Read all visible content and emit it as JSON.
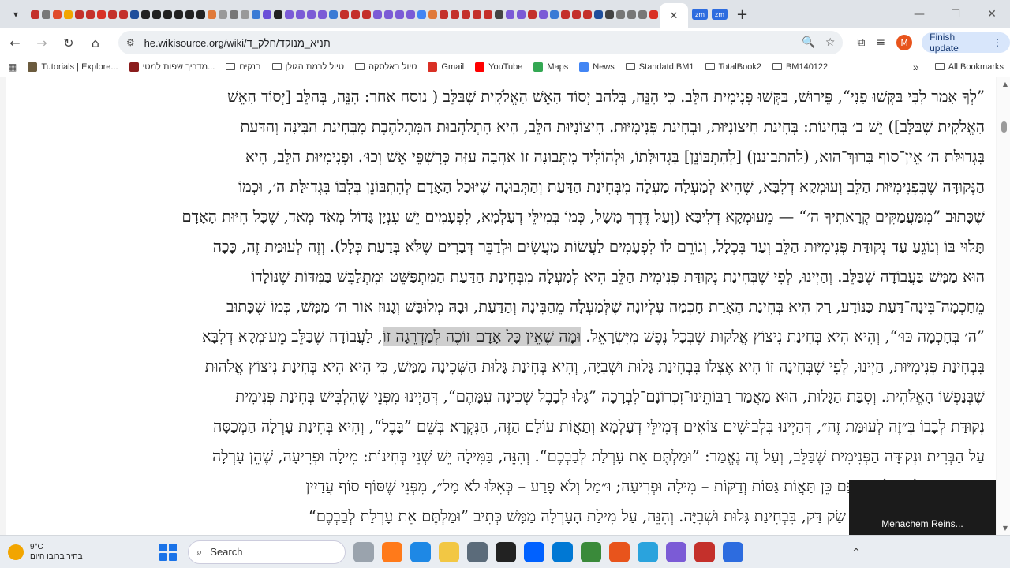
{
  "browser": {
    "active_tab_label": "✕",
    "tab_zm_label": "zm",
    "new_tab": "+",
    "url": "he.wikisource.org/wiki/תניא_מנוקד/חלק_ד",
    "finish_update": "Finish update",
    "profile_initial": "M",
    "window_controls": {
      "minimize": "—",
      "maximize": "☐",
      "close": "✕"
    }
  },
  "bookmarks": {
    "items": [
      {
        "label": "Tutorials | Explore...",
        "color": "#6b5b3e"
      },
      {
        "label": "מדריך שפות למטי...",
        "color": "#8a1c1c"
      },
      {
        "label": "בנקים",
        "folder": true
      },
      {
        "label": "טיול לרמת הגולן",
        "folder": true
      },
      {
        "label": "טיול באלסקה",
        "folder": true
      },
      {
        "label": "Gmail",
        "color": "#d93025"
      },
      {
        "label": "YouTube",
        "color": "#ff0000"
      },
      {
        "label": "Maps",
        "color": "#34a853"
      },
      {
        "label": "News",
        "color": "#4285f4"
      },
      {
        "label": "Standatd BM1",
        "folder": true
      },
      {
        "label": "TotalBook2",
        "folder": true
      },
      {
        "label": "BM140122",
        "folder": true
      }
    ],
    "more": "»",
    "all_bookmarks": "All Bookmarks"
  },
  "article": {
    "lines": [
      "”לְךָ אָמַר לִבִּי בַּקְּשׁוּ פָנָי“, פֵּירוּשׁ, בַּקְּשׁוּ פְּנִימִית הַלֵּב. כִּי הִנֵּה, בְּלַהַב יְסוֹד הָאֵשׁ הָאֱלֹקִית שֶׁבַּלֵּב ( נוסח אחר: הִנֵּה, בְּהַלֵּב [יְסוֹד הָאֵשׁ",
      "הָאֱלֹקִית שֶׁבַּלֵּב]) יֵשׁ ב׳ בְּחִינוֹת: בְּחִינַת חִיצוֹנִיּוּת, וּבְחִינַת פְּנִימִיּוּת. חִיצוֹנִיּוּת הַלֵּב, הִיא הִתְלַהֲבוּת הַמִּתְלַהֶבֶת מִבְּחִינַת הַבִּינָה וְהַדַּעַת",
      "בִּגְדוּלַּת ה׳ אֵין־סוֹף בָּרוּךְ־הוּא, (להתבוננן) [לְהִתְבּוֹנֵן] בִּגְדוּלָּתוֹ, וּלְהוֹלִיד מִתְּבוּנָה זוֹ אַהֲבָה עַזָּה כְּרִשְׁפֵּי אֵשׁ וְכוּ׳. וּפְנִימִיּוּת הַלֵּב, הִיא",
      "הַנְּקוּדָּה שֶׁבִּפְנִימִיּוּת הַלֵּב וְעוּמְקָא דְלִבָּא, שֶׁהִיא לְמַעְלָה מַעְלָה מִבְּחִינַת הַדַּעַת וְהַתְּבוּנָה שֶׁיּוּכַל הָאָדָם לְהִתְבּוֹנֵן בְּלִבּוֹ בִּגְדוּלַּת ה׳, וּכְמוֹ",
      "שֶׁכָּתוּב ”מִמַּעֲמַקִּים קְרָאתִיךָ ה׳“ — מֵעוּמְקָא דְלִיבָּא (וְעַל דֶּרֶךְ מָשָׁל, כְּמוֹ בְּמִילֵּי דְעָלְמָא, לִפְעָמִים יֵשׁ עִנְיָן גָּדוֹל מְאֹד מְאֹד, שֶׁכָּל חִיּוּת הָאָדָם",
      "תָּלוּי בּוֹ וְנוֹגֵעַ עַד נְקוּדַּת פְּנִימִיּוּת הַלֵּב וְעַד בִּכְלָל, וְגוֹרֵם לוֹ לִפְעָמִים לַעֲשׂוֹת מַעֲשִׂים וּלְדַבֵּר דְּבָרִים שֶׁלֹּא בְּדַעַת כְּלָל). וְזֶה לְעוּמַּת זֶה, כָּכָה",
      "הוּא מַמָּשׁ בַּעֲבוֹדָה שֶׁבַּלֵּב. וְהַיְינוּ, לְפִי שֶׁבְּחִינַת נְקוּדַּת פְּנִימִית הַלֵּב הִיא לְמַעְלָה מִבְּחִינַת הַדַּעַת הַמִּתְפַּשֵּׁט וּמִתְלַבֵּשׁ בַּמִּדּוֹת שֶׁנּוֹלָדוֹ",
      "מֵחָכְמָה־בִּינָה־דַּעַת כַּנּוֹדָע, רַק הִיא בְּחִינַת הֶאָרַת חָכְמָה עֶלְיוֹנָה שֶׁלְּמַעְלָה מֵהַבִּינָה וְהַדַּעַת, וּבָהּ מְלוּבָּשׁ וְגָנוּז אוֹר ה׳ מַמָּשׁ, כְּמוֹ שֶׁכָּתוּב",
      "”ה׳ בְּחָכְמָה כּוּ׳“, וְהִיא הִיא בְּחִינַת נִיצוֹץ אֱלֹקוּת שֶׁבְּכָל נֶפֶשׁ מִיִּשְׂרָאֵל. <span class='hl'>וּמָה שֶׁאֵין כָּל אָדָם זוֹכֶה לְמַדְרֵגָה זוֹ</span>, לַעֲבוֹדָה שֶׁבַּלֵּב מֵעוּמְקָא דְלִבָּא",
      "בִּבְחִינַת פְּנִימִיּוּת, הַיְינוּ, לְפִי שֶׁבְּחִינָה זוֹ הִיא אֶצְלוֹ בִּבְחִינַת גָּלוּת וּשְׁבִיָּה, וְהִיא בְּחִינַת גָּלוּת הַשְּׁכִינָה מַמָּשׁ, כִּי הִיא הִיא בְּחִינַת נִיצוֹץ אֱלֹהוּת",
      "שֶׁבְּנַפְשׁוֹ הָאֱלֹהִית. וְסִבַּת הַגָּלוּת, הוּא מַאֲמַר רַבּוֹתֵינוּ־זִכְרוֹנָם־לִבְרָכָה ”גָּלוּ לְבָבֶל שְׁכִינָה עִמָּהֶם“, דְּהַיְינוּ מִפְּנֵי שֶׁהִלְבִּישׁ בְּחִינַת פְּנִימִית",
      "נְקוּדַּת לְבָבוֹ בְּ״זֶה לְעוּמַּת זֶה״, דְּהַיְינוּ בִּלְבוּשִׁים צוֹאִים דְּמִילֵּי דְעָלְמָא וְתַאֲוֹת עוֹלָם הַזֶּה, הַנִּקְרָא בְּשֵׁם ”בָּבֶל“, וְהִיא בְּחִינַת עָרְלָה הַמְכַסָּה",
      "עַל הַבְּרִית וּנְקוּדָּה הַפְּנִימִית שֶׁבַּלֵּב, וְעַל זֶה נֶאֱמַר: ”וּמַלְתֶּם אֵת עָרְלַת לְבַבְכֶם“. וְהִנֵּה, בַּמִּילָה יֵשׁ שְׁנֵי בְּחִינוֹת: מִילָה וּפְרִיעָה, שֶׁהֵן עָרְלָה",
      "... וְכֵן בְּעָרְלַת הַלֵּב יֵשׁ גַּם כֵּן תַּאֲוֹת גַּסּוֹת וְדַקּוֹת – מִילָה וּפְרִיעָה; וּ״מַל וְלֹא פָרַע – כְּאִלּוּ לֹא מָל״, מִפְּנֵי שֶׁסּוֹף סוֹף עֲדַיִין",
      "...ב הִיא מְכוּסָּה בִּלְבוּשׁ שַׂק דַּק, בִּבְחִינַת גָּלוּת וּשְׁבִיָּה. וְהִנֵּה, עַל מִילַת הָעָרְלָה מַמָּשׁ כְּתִיב ”וּמַלְתֶּם אֵת עָרְלַת לְבַבְכֶם“"
    ]
  },
  "overlay": {
    "label": "Menachem Reins..."
  },
  "taskbar": {
    "weather_temp": "9°C",
    "weather_desc": "בהיר ברובו היום",
    "search_placeholder": "Search",
    "tray_caret": "^"
  },
  "colors": {
    "tabstrip": "#dfe3e8",
    "finish_update_bg": "#d8e6fb",
    "profile": "#e8541c",
    "highlight": "#cfcfcf"
  }
}
